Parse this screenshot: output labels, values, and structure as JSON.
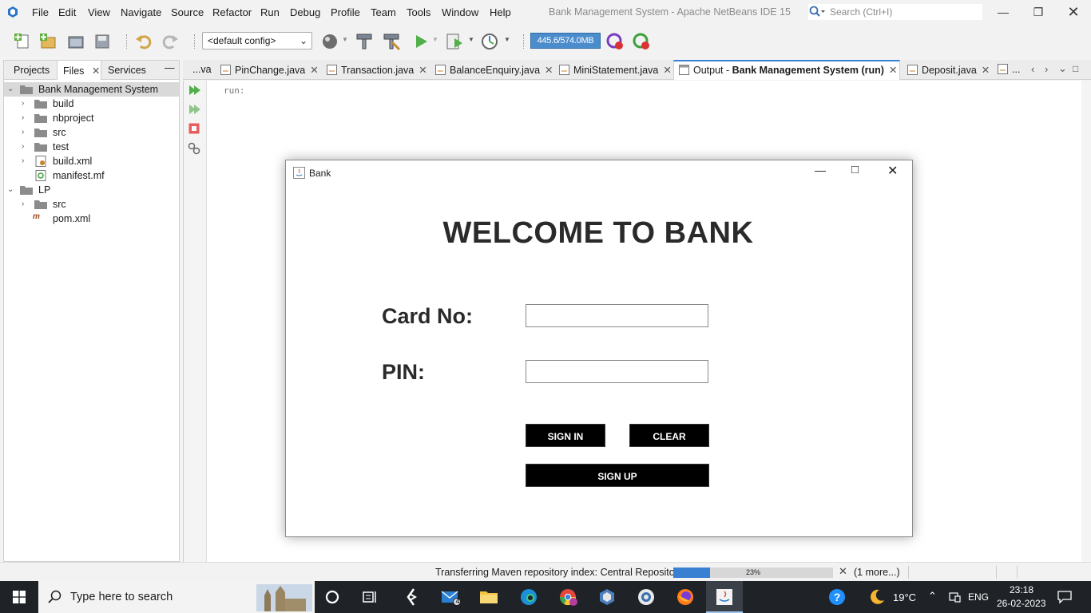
{
  "menubar": {
    "items": [
      "File",
      "Edit",
      "View",
      "Navigate",
      "Source",
      "Refactor",
      "Run",
      "Debug",
      "Profile",
      "Team",
      "Tools",
      "Window",
      "Help"
    ],
    "title": "Bank Management System - Apache NetBeans IDE 15",
    "search_placeholder": "Search (Ctrl+I)"
  },
  "toolbar": {
    "config": "<default config>",
    "memory": "445.6/574.0MB"
  },
  "left_panel": {
    "tabs": [
      "Projects",
      "Files",
      "Services"
    ],
    "active_tab": "Files",
    "tree": [
      {
        "label": "Bank Management System",
        "level": 0,
        "expanded": true,
        "type": "project"
      },
      {
        "label": "build",
        "level": 1,
        "expanded": false,
        "type": "folder"
      },
      {
        "label": "nbproject",
        "level": 1,
        "expanded": false,
        "type": "folder"
      },
      {
        "label": "src",
        "level": 1,
        "expanded": false,
        "type": "folder"
      },
      {
        "label": "test",
        "level": 1,
        "expanded": false,
        "type": "folder"
      },
      {
        "label": "build.xml",
        "level": 1,
        "expanded": false,
        "type": "xml"
      },
      {
        "label": "manifest.mf",
        "level": 1,
        "expanded": null,
        "type": "mf"
      },
      {
        "label": "LP",
        "level": 0,
        "expanded": true,
        "type": "project"
      },
      {
        "label": "src",
        "level": 1,
        "expanded": false,
        "type": "folder"
      },
      {
        "label": "pom.xml",
        "level": 1,
        "expanded": null,
        "type": "maven"
      }
    ]
  },
  "editor_tabs": [
    {
      "label": "...va",
      "active": false
    },
    {
      "label": "PinChange.java",
      "active": false
    },
    {
      "label": "Transaction.java",
      "active": false
    },
    {
      "label": "BalanceEnquiry.java",
      "active": false
    },
    {
      "label": "MiniStatement.java",
      "active": false
    },
    {
      "label": "Output - ",
      "bold": "Bank Management System (run)",
      "active": true
    },
    {
      "label": "Deposit.java",
      "active": false
    },
    {
      "label": "...",
      "active": false
    }
  ],
  "output": {
    "text": "run:"
  },
  "bank_window": {
    "title": "Bank",
    "heading": "WELCOME TO BANK",
    "card_label": "Card No:",
    "card_value": "",
    "pin_label": "PIN:",
    "pin_value": "",
    "sign_in": "SIGN IN",
    "clear": "CLEAR",
    "sign_up": "SIGN UP"
  },
  "statusbar": {
    "text": "Transferring Maven repository index: Central Repository",
    "progress": 0.23,
    "progress_label": "23%",
    "more": "(1 more...)"
  },
  "taskbar": {
    "search_placeholder": "Type here to search",
    "mail_badge": "4",
    "weather": "19°C",
    "lang": "ENG",
    "time": "23:18",
    "date": "26-02-2023"
  },
  "colors": {
    "accent": "#3a80d2",
    "button_bg": "#000000",
    "taskbar": "#1f2328"
  }
}
